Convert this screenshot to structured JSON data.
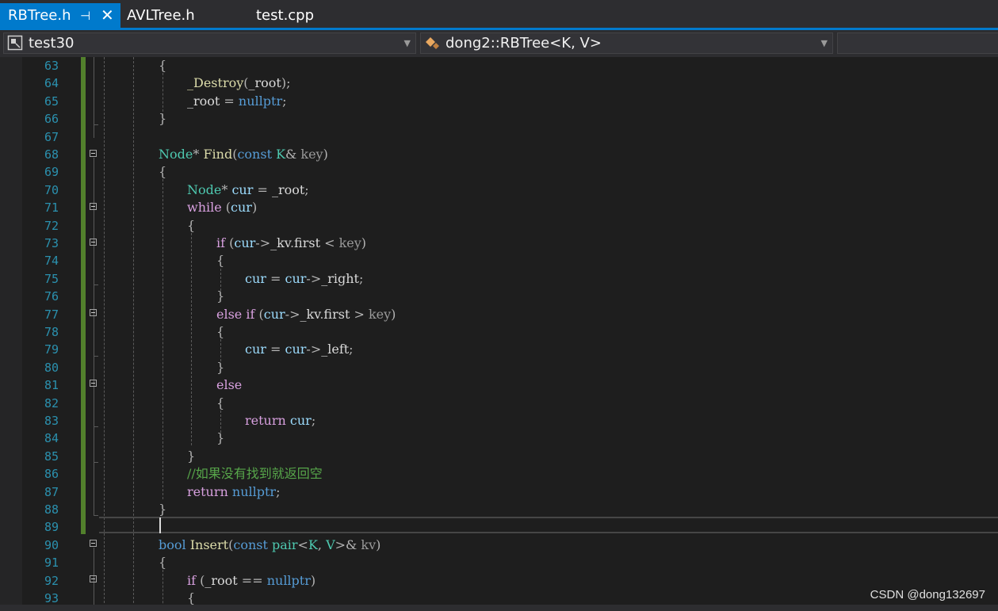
{
  "tabs": [
    {
      "label": "RBTree.h",
      "active": true,
      "pin_icon": "pin-icon",
      "close_icon": "close-icon"
    },
    {
      "label": "AVLTree.h",
      "active": false
    },
    {
      "label": "test.cpp",
      "active": false
    }
  ],
  "navbar": {
    "project": "test30",
    "scope": "dong2::RBTree<K, V>",
    "member": ""
  },
  "editor": {
    "line_numbers": [
      "63",
      "64",
      "65",
      "66",
      "67",
      "68",
      "69",
      "70",
      "71",
      "72",
      "73",
      "74",
      "75",
      "76",
      "77",
      "78",
      "79",
      "80",
      "81",
      "82",
      "83",
      "84",
      "85",
      "86",
      "87",
      "88",
      "89",
      "90",
      "91",
      "92",
      "93"
    ],
    "code": {
      "l63": "{",
      "l64a": "_Destroy",
      "l64b": "(",
      "l64c": "_root",
      "l64d": ");",
      "l65a": "_root",
      "l65b": " = ",
      "l65c": "nullptr",
      "l65d": ";",
      "l66": "}",
      "l68a": "Node",
      "l68b": "* ",
      "l68c": "Find",
      "l68d": "(",
      "l68e": "const",
      "l68f": " ",
      "l68g": "K",
      "l68h": "& ",
      "l68i": "key",
      "l68j": ")",
      "l69": "{",
      "l70a": "Node",
      "l70b": "* ",
      "l70c": "cur",
      "l70d": " = ",
      "l70e": "_root",
      "l70f": ";",
      "l71a": "while",
      "l71b": " (",
      "l71c": "cur",
      "l71d": ")",
      "l72": "{",
      "l73a": "if",
      "l73b": " (",
      "l73c": "cur",
      "l73d": "->",
      "l73e": "_kv",
      "l73f": ".",
      "l73g": "first",
      "l73h": " < ",
      "l73i": "key",
      "l73j": ")",
      "l74": "{",
      "l75a": "cur",
      "l75b": " = ",
      "l75c": "cur",
      "l75d": "->",
      "l75e": "_right",
      "l75f": ";",
      "l76": "}",
      "l77a": "else",
      "l77b": " ",
      "l77c": "if",
      "l77d": " (",
      "l77e": "cur",
      "l77f": "->",
      "l77g": "_kv",
      "l77h": ".",
      "l77i": "first",
      "l77j": " > ",
      "l77k": "key",
      "l77l": ")",
      "l78": "{",
      "l79a": "cur",
      "l79b": " = ",
      "l79c": "cur",
      "l79d": "->",
      "l79e": "_left",
      "l79f": ";",
      "l80": "}",
      "l81": "else",
      "l82": "{",
      "l83a": "return",
      "l83b": " ",
      "l83c": "cur",
      "l83d": ";",
      "l84": "}",
      "l85": "}",
      "l86": "//如果没有找到就返回空",
      "l87a": "return",
      "l87b": " ",
      "l87c": "nullptr",
      "l87d": ";",
      "l88": "}",
      "l90a": "bool",
      "l90b": " ",
      "l90c": "Insert",
      "l90d": "(",
      "l90e": "const",
      "l90f": " ",
      "l90g": "pair",
      "l90h": "<",
      "l90i": "K",
      "l90j": ", ",
      "l90k": "V",
      "l90l": ">& ",
      "l90m": "kv",
      "l90n": ")",
      "l91": "{",
      "l92a": "if",
      "l92b": " (",
      "l92c": "_root",
      "l92d": " == ",
      "l92e": "nullptr",
      "l92f": ")",
      "l93": "{"
    }
  },
  "watermark": "CSDN @dong132697"
}
